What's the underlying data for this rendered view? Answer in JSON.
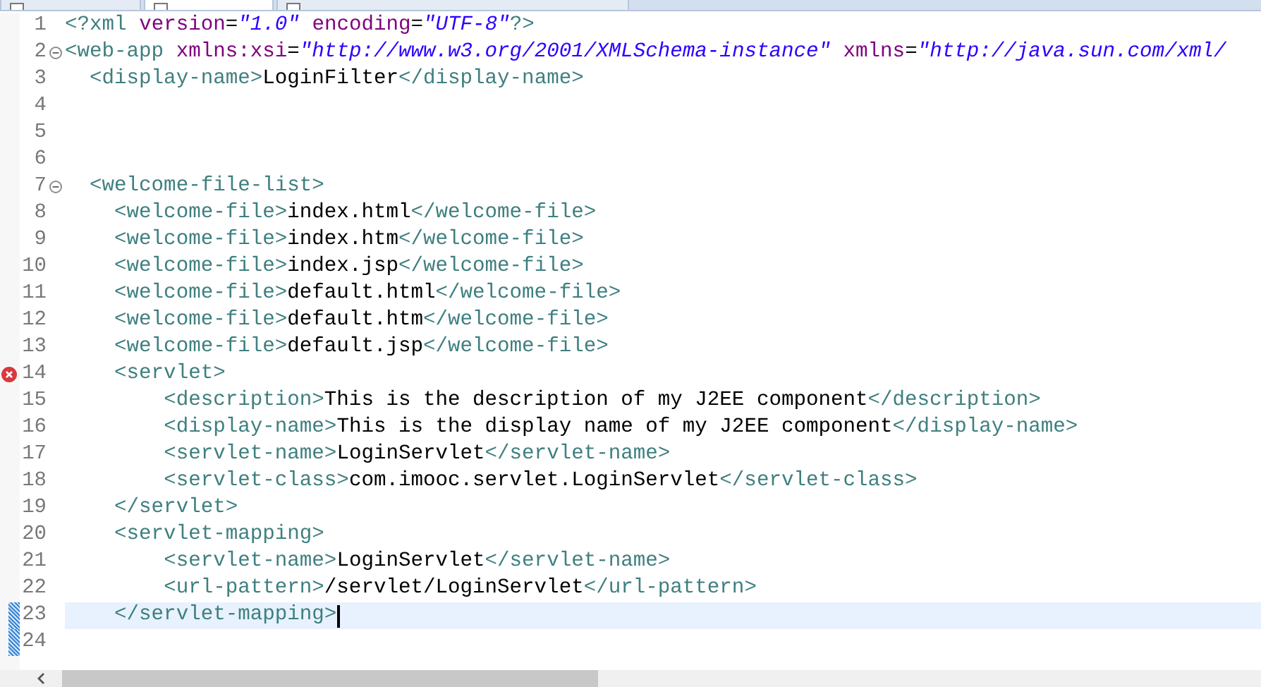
{
  "tabs": [
    {
      "selected": false
    },
    {
      "selected": true
    },
    {
      "selected": false
    }
  ],
  "editor": {
    "lines": [
      {
        "n": "1",
        "code": "<?xml version=\"1.0\" encoding=\"UTF-8\"?>"
      },
      {
        "n": "2",
        "expanded": true,
        "code": "<web-app xmlns:xsi=\"http://www.w3.org/2001/XMLSchema-instance\" xmlns=\"http://java.sun.com/xml/"
      },
      {
        "n": "3",
        "code": "  <display-name>LoginFilter</display-name>"
      },
      {
        "n": "4"
      },
      {
        "n": "5"
      },
      {
        "n": "6"
      },
      {
        "n": "7",
        "expanded": true,
        "code": "  <welcome-file-list>"
      },
      {
        "n": "8",
        "code": "    <welcome-file>index.html</welcome-file>"
      },
      {
        "n": "9",
        "code": "    <welcome-file>index.htm</welcome-file>"
      },
      {
        "n": "10",
        "code": "    <welcome-file>index.jsp</welcome-file>"
      },
      {
        "n": "11",
        "code": "    <welcome-file>default.html</welcome-file>"
      },
      {
        "n": "12",
        "code": "    <welcome-file>default.htm</welcome-file>"
      },
      {
        "n": "13",
        "code": "    <welcome-file>default.jsp</welcome-file>"
      },
      {
        "n": "14",
        "error": true,
        "code": "    <servlet>"
      },
      {
        "n": "15",
        "code": "        <description>This is the description of my J2EE component</description>"
      },
      {
        "n": "16",
        "code": "        <display-name>This is the display name of my J2EE component</display-name>"
      },
      {
        "n": "17",
        "code": "        <servlet-name>LoginServlet</servlet-name>"
      },
      {
        "n": "18",
        "code": "        <servlet-class>com.imooc.servlet.LoginServlet</servlet-class>"
      },
      {
        "n": "19",
        "code": "    </servlet>"
      },
      {
        "n": "20",
        "code": "    <servlet-mapping>"
      },
      {
        "n": "21",
        "code": "        <servlet-name>LoginServlet</servlet-name>"
      },
      {
        "n": "22",
        "code": "        <url-pattern>/servlet/LoginServlet</url-pattern>"
      },
      {
        "n": "23",
        "changed": true,
        "current": true,
        "code": "    </servlet-mapping>"
      },
      {
        "n": "24",
        "changed": true
      }
    ]
  }
}
